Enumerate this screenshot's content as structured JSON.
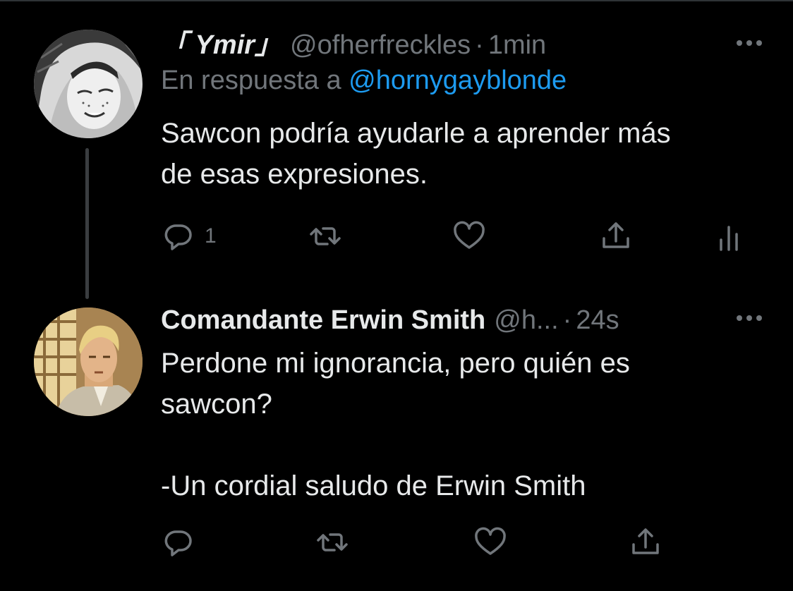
{
  "theme": {
    "background": "#000000",
    "text": "#e7e9ea",
    "muted": "#71767b",
    "link": "#1d9bf0"
  },
  "tweets": [
    {
      "display_name": "「 Ymir」",
      "handle": "@ofherfreckles",
      "separator": "·",
      "time": "1min",
      "reply_prefix": "En respuesta a",
      "reply_mention": "@hornygayblonde",
      "text": "Sawcon podría ayudarle a aprender más\nde esas expresiones.",
      "more_icon": "more-horizontal-icon",
      "actions": {
        "reply_count": "1",
        "icons": [
          "reply-icon",
          "retweet-icon",
          "like-icon",
          "share-icon",
          "analytics-icon"
        ]
      }
    },
    {
      "display_name": "Comandante Erwin Smith",
      "handle": "@h...",
      "separator": "·",
      "time": "24s",
      "text": "Perdone mi ignorancia, pero quién es\nsawcon?\n\n-Un cordial saludo de Erwin Smith",
      "more_icon": "more-horizontal-icon",
      "actions": {
        "icons": [
          "reply-icon",
          "retweet-icon",
          "like-icon",
          "share-icon"
        ]
      }
    }
  ]
}
